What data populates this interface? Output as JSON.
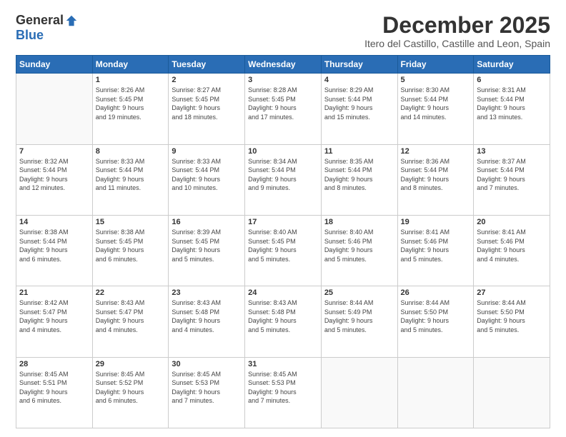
{
  "logo": {
    "general": "General",
    "blue": "Blue"
  },
  "header": {
    "month": "December 2025",
    "location": "Itero del Castillo, Castille and Leon, Spain"
  },
  "days_of_week": [
    "Sunday",
    "Monday",
    "Tuesday",
    "Wednesday",
    "Thursday",
    "Friday",
    "Saturday"
  ],
  "weeks": [
    [
      {
        "day": "",
        "info": ""
      },
      {
        "day": "1",
        "info": "Sunrise: 8:26 AM\nSunset: 5:45 PM\nDaylight: 9 hours\nand 19 minutes."
      },
      {
        "day": "2",
        "info": "Sunrise: 8:27 AM\nSunset: 5:45 PM\nDaylight: 9 hours\nand 18 minutes."
      },
      {
        "day": "3",
        "info": "Sunrise: 8:28 AM\nSunset: 5:45 PM\nDaylight: 9 hours\nand 17 minutes."
      },
      {
        "day": "4",
        "info": "Sunrise: 8:29 AM\nSunset: 5:44 PM\nDaylight: 9 hours\nand 15 minutes."
      },
      {
        "day": "5",
        "info": "Sunrise: 8:30 AM\nSunset: 5:44 PM\nDaylight: 9 hours\nand 14 minutes."
      },
      {
        "day": "6",
        "info": "Sunrise: 8:31 AM\nSunset: 5:44 PM\nDaylight: 9 hours\nand 13 minutes."
      }
    ],
    [
      {
        "day": "7",
        "info": "Sunrise: 8:32 AM\nSunset: 5:44 PM\nDaylight: 9 hours\nand 12 minutes."
      },
      {
        "day": "8",
        "info": "Sunrise: 8:33 AM\nSunset: 5:44 PM\nDaylight: 9 hours\nand 11 minutes."
      },
      {
        "day": "9",
        "info": "Sunrise: 8:33 AM\nSunset: 5:44 PM\nDaylight: 9 hours\nand 10 minutes."
      },
      {
        "day": "10",
        "info": "Sunrise: 8:34 AM\nSunset: 5:44 PM\nDaylight: 9 hours\nand 9 minutes."
      },
      {
        "day": "11",
        "info": "Sunrise: 8:35 AM\nSunset: 5:44 PM\nDaylight: 9 hours\nand 8 minutes."
      },
      {
        "day": "12",
        "info": "Sunrise: 8:36 AM\nSunset: 5:44 PM\nDaylight: 9 hours\nand 8 minutes."
      },
      {
        "day": "13",
        "info": "Sunrise: 8:37 AM\nSunset: 5:44 PM\nDaylight: 9 hours\nand 7 minutes."
      }
    ],
    [
      {
        "day": "14",
        "info": "Sunrise: 8:38 AM\nSunset: 5:44 PM\nDaylight: 9 hours\nand 6 minutes."
      },
      {
        "day": "15",
        "info": "Sunrise: 8:38 AM\nSunset: 5:45 PM\nDaylight: 9 hours\nand 6 minutes."
      },
      {
        "day": "16",
        "info": "Sunrise: 8:39 AM\nSunset: 5:45 PM\nDaylight: 9 hours\nand 5 minutes."
      },
      {
        "day": "17",
        "info": "Sunrise: 8:40 AM\nSunset: 5:45 PM\nDaylight: 9 hours\nand 5 minutes."
      },
      {
        "day": "18",
        "info": "Sunrise: 8:40 AM\nSunset: 5:46 PM\nDaylight: 9 hours\nand 5 minutes."
      },
      {
        "day": "19",
        "info": "Sunrise: 8:41 AM\nSunset: 5:46 PM\nDaylight: 9 hours\nand 5 minutes."
      },
      {
        "day": "20",
        "info": "Sunrise: 8:41 AM\nSunset: 5:46 PM\nDaylight: 9 hours\nand 4 minutes."
      }
    ],
    [
      {
        "day": "21",
        "info": "Sunrise: 8:42 AM\nSunset: 5:47 PM\nDaylight: 9 hours\nand 4 minutes."
      },
      {
        "day": "22",
        "info": "Sunrise: 8:43 AM\nSunset: 5:47 PM\nDaylight: 9 hours\nand 4 minutes."
      },
      {
        "day": "23",
        "info": "Sunrise: 8:43 AM\nSunset: 5:48 PM\nDaylight: 9 hours\nand 4 minutes."
      },
      {
        "day": "24",
        "info": "Sunrise: 8:43 AM\nSunset: 5:48 PM\nDaylight: 9 hours\nand 5 minutes."
      },
      {
        "day": "25",
        "info": "Sunrise: 8:44 AM\nSunset: 5:49 PM\nDaylight: 9 hours\nand 5 minutes."
      },
      {
        "day": "26",
        "info": "Sunrise: 8:44 AM\nSunset: 5:50 PM\nDaylight: 9 hours\nand 5 minutes."
      },
      {
        "day": "27",
        "info": "Sunrise: 8:44 AM\nSunset: 5:50 PM\nDaylight: 9 hours\nand 5 minutes."
      }
    ],
    [
      {
        "day": "28",
        "info": "Sunrise: 8:45 AM\nSunset: 5:51 PM\nDaylight: 9 hours\nand 6 minutes."
      },
      {
        "day": "29",
        "info": "Sunrise: 8:45 AM\nSunset: 5:52 PM\nDaylight: 9 hours\nand 6 minutes."
      },
      {
        "day": "30",
        "info": "Sunrise: 8:45 AM\nSunset: 5:53 PM\nDaylight: 9 hours\nand 7 minutes."
      },
      {
        "day": "31",
        "info": "Sunrise: 8:45 AM\nSunset: 5:53 PM\nDaylight: 9 hours\nand 7 minutes."
      },
      {
        "day": "",
        "info": ""
      },
      {
        "day": "",
        "info": ""
      },
      {
        "day": "",
        "info": ""
      }
    ]
  ]
}
